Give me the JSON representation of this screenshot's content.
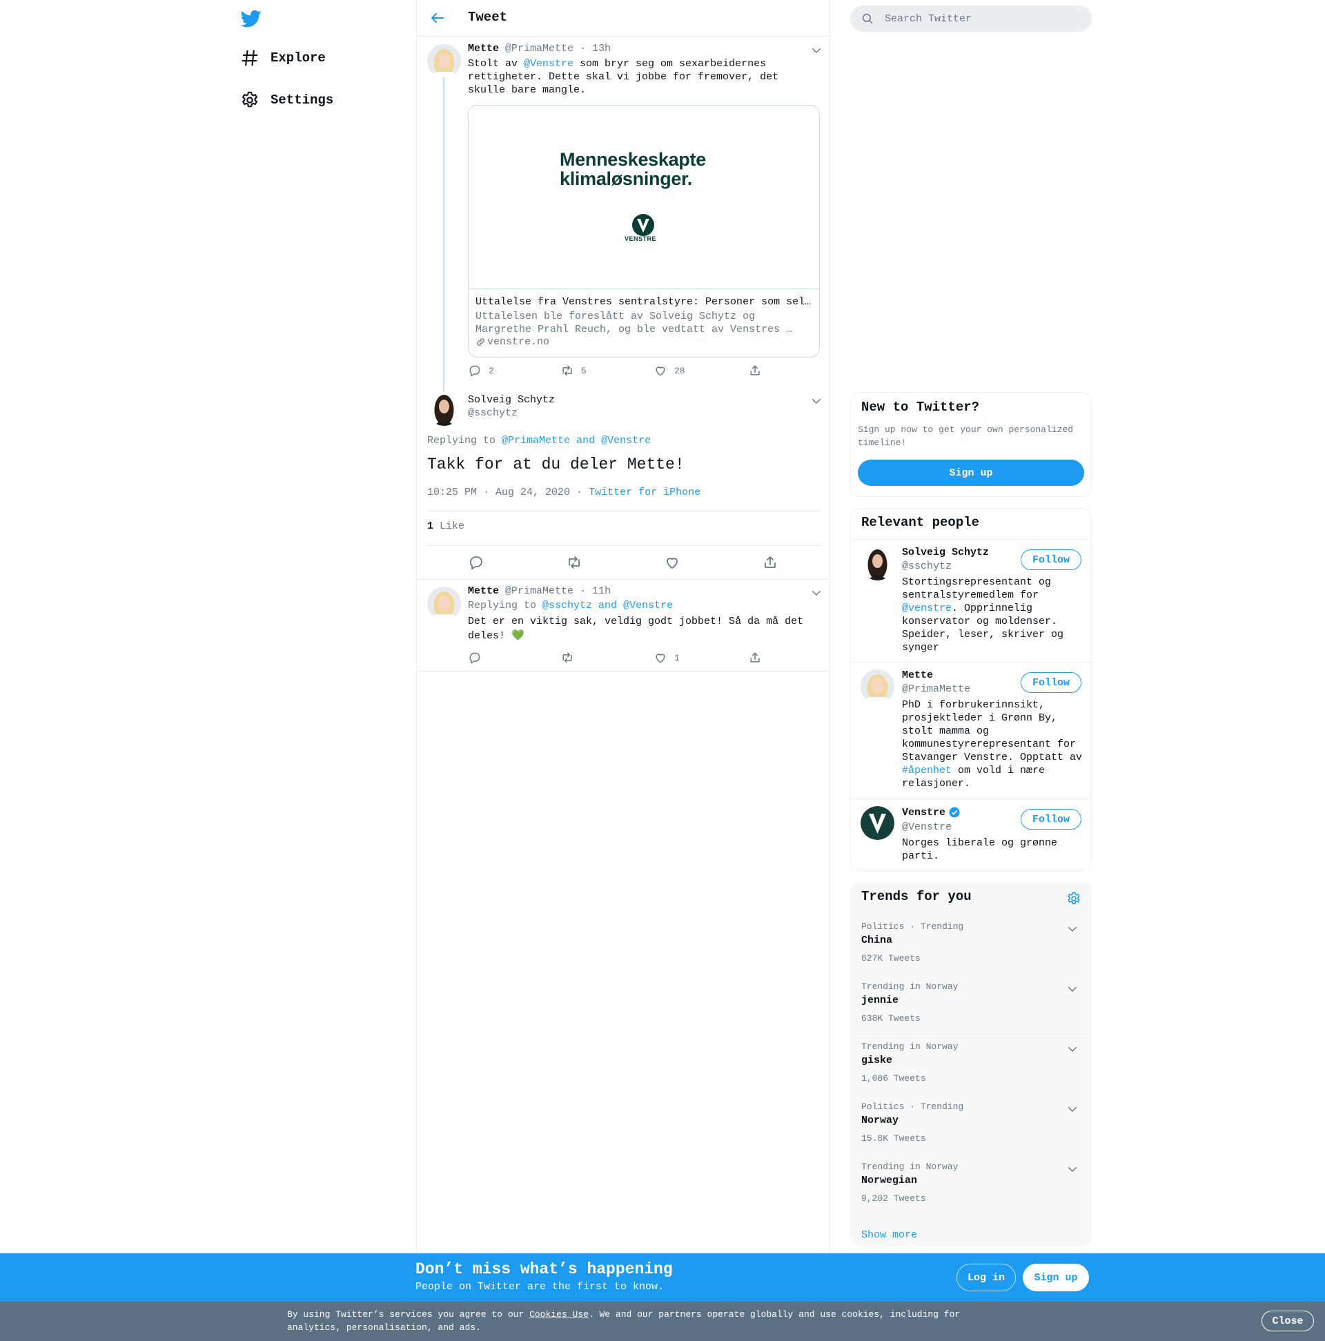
{
  "nav": {
    "explore": "Explore",
    "settings": "Settings"
  },
  "header": {
    "title": "Tweet"
  },
  "tweet1": {
    "name": "Mette",
    "handle": "@PrimaMette",
    "time": "· 13h",
    "text_a": "Stolt av ",
    "mention": "@Venstre",
    "text_b": " som bryr seg om sexarbeidernes rettigheter. Dette skal vi jobbe for fremover, det skulle bare mangle.",
    "card": {
      "image_line1": "Menneskeskapte",
      "image_line2": "klimaløsninger.",
      "image_logo_text": "VENSTRE",
      "title": "Uttalelse fra Venstres sentralstyre: Personer som selger sex må sikres rettigheter",
      "desc": "Uttalelsen ble foreslått av Solveig Schytz og Margrethe Prahl Reuch, og ble vedtatt av Venstres …",
      "domain": "venstre.no"
    },
    "replies": "2",
    "retweets": "5",
    "likes": "28"
  },
  "focus": {
    "name": "Solveig Schytz",
    "handle": "@sschytz",
    "replying_prefix": "Replying to ",
    "replying_a": "@PrimaMette",
    "replying_and": " and ",
    "replying_b": "@Venstre",
    "text": "Takk for at du deler Mette!",
    "timestamp": "10:25 PM · Aug 24, 2020",
    "dot": " · ",
    "source": "Twitter for iPhone",
    "like_count": "1",
    "like_label": "Like"
  },
  "reply": {
    "name": "Mette",
    "handle": "@PrimaMette",
    "time": "· 11h",
    "replying_prefix": "Replying to ",
    "replying_a": "@sschytz",
    "replying_and": " and ",
    "replying_b": "@Venstre",
    "text": "Det er en viktig sak, veldig godt jobbet! Så da må det deles! 💚",
    "likes": "1"
  },
  "search": {
    "placeholder": "Search Twitter"
  },
  "new_to_twitter": {
    "title": "New to Twitter?",
    "text": "Sign up now to get your own personalized timeline!",
    "button": "Sign up"
  },
  "relevant": {
    "title": "Relevant people",
    "follow_label": "Follow",
    "people": [
      {
        "name": "Solveig Schytz",
        "handle": "@sschytz",
        "bio_a": "Stortingsrepresentant og sentralstyremedlem for ",
        "bio_link": "@venstre",
        "bio_b": ". Opprinnelig konservator og moldenser. Speider, leser, skriver og synger"
      },
      {
        "name": "Mette",
        "handle": "@PrimaMette",
        "bio_a": "PhD i forbrukerinnsikt, prosjektleder i Grønn By, stolt mamma og kommunestyrerepresentant for Stavanger Venstre. Opptatt av ",
        "bio_link": "#åpenhet",
        "bio_b": " om vold i nære relasjoner."
      },
      {
        "name": "Venstre",
        "handle": "@Venstre",
        "bio_a": "Norges liberale og grønne parti.",
        "bio_link": "",
        "bio_b": ""
      }
    ]
  },
  "trends": {
    "title": "Trends for you",
    "items": [
      {
        "context": "Politics · Trending",
        "name": "China",
        "count": "627K Tweets"
      },
      {
        "context": "Trending in Norway",
        "name": "jennie",
        "count": "638K Tweets"
      },
      {
        "context": "Trending in Norway",
        "name": "giske",
        "count": "1,086 Tweets"
      },
      {
        "context": "Politics · Trending",
        "name": "Norway",
        "count": "15.8K Tweets"
      },
      {
        "context": "Trending in Norway",
        "name": "Norwegian",
        "count": "9,202 Tweets"
      }
    ],
    "show_more": "Show more"
  },
  "banner": {
    "title": "Don’t miss what’s happening",
    "subtitle": "People on Twitter are the first to know.",
    "login": "Log in",
    "signup": "Sign up"
  },
  "cookie": {
    "text_a": "By using Twitter’s services you agree to our ",
    "link": "Cookies Use",
    "text_b": ". We and our partners operate globally and use cookies, including for analytics, personalisation, and ads.",
    "close": "Close"
  },
  "colors": {
    "accent": "#1d9bf0",
    "secondary_text": "#6b7885",
    "cookie_bar": "#5b7083"
  }
}
